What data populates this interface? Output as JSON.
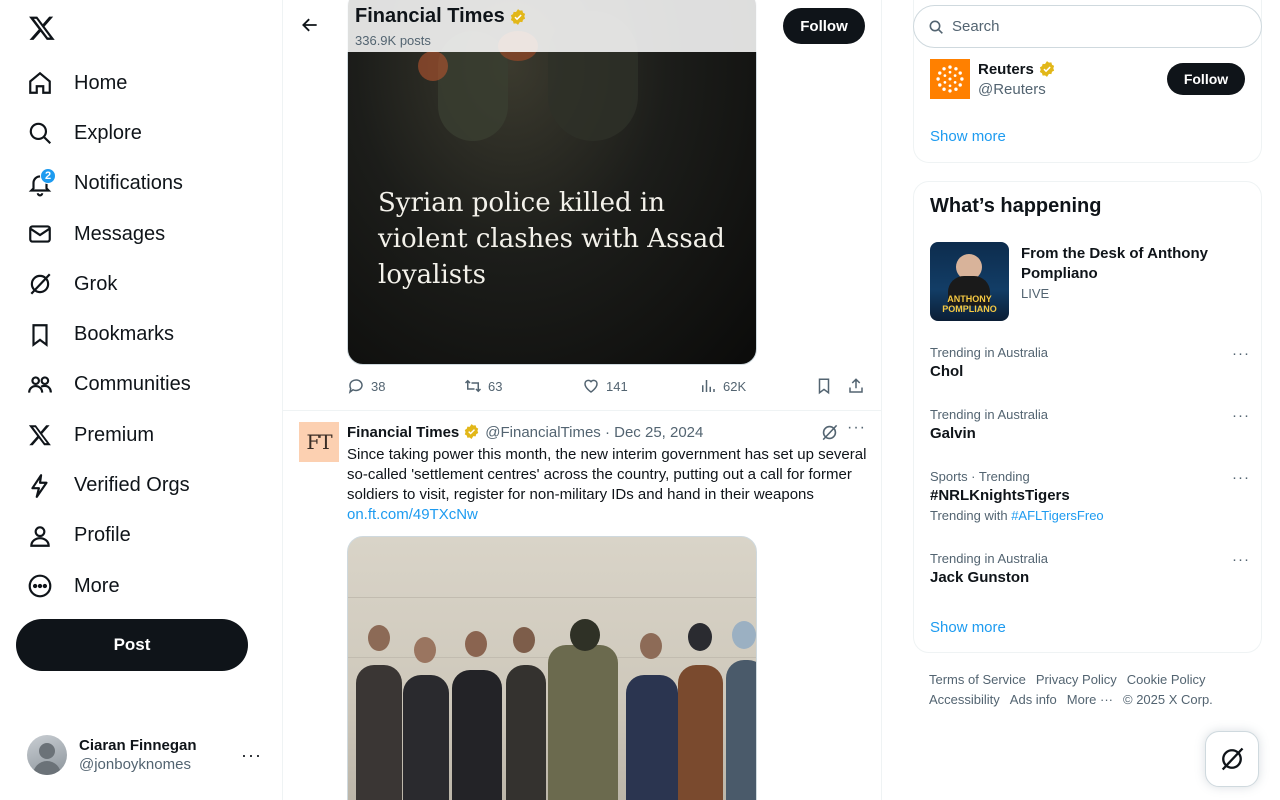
{
  "nav": {
    "items": [
      {
        "label": "Home",
        "icon": "home-icon"
      },
      {
        "label": "Explore",
        "icon": "search-icon"
      },
      {
        "label": "Notifications",
        "icon": "bell-icon",
        "badge": "2"
      },
      {
        "label": "Messages",
        "icon": "envelope-icon"
      },
      {
        "label": "Grok",
        "icon": "grok-icon"
      },
      {
        "label": "Bookmarks",
        "icon": "bookmark-icon"
      },
      {
        "label": "Communities",
        "icon": "people-icon"
      },
      {
        "label": "Premium",
        "icon": "x-logo-icon"
      },
      {
        "label": "Verified Orgs",
        "icon": "lightning-icon"
      },
      {
        "label": "Profile",
        "icon": "person-icon"
      },
      {
        "label": "More",
        "icon": "more-circle-icon"
      }
    ],
    "post_label": "Post",
    "account": {
      "name": "Ciaran Finnegan",
      "handle": "@jonboyknomes",
      "more": "···"
    }
  },
  "header": {
    "title": "Financial Times",
    "subtitle": "336.9K posts",
    "follow_label": "Follow"
  },
  "top_post": {
    "image_headline": "Syrian police killed in violent clashes with Assad loyalists",
    "actions": {
      "replies": "38",
      "reposts": "63",
      "likes": "141",
      "views": "62K"
    }
  },
  "tweet": {
    "avatar_text": "FT",
    "author": "Financial Times",
    "meta": "@FinancialTimes · Dec 25, 2024",
    "more": "···",
    "text": "Since taking power this month, the new interim government has set up several so-called 'settlement centres' across the country, putting out a call for former soldiers to visit, register for non-military IDs and hand in their weapons ",
    "link": "on.ft.com/49TXcNw"
  },
  "search": {
    "placeholder": "Search"
  },
  "who_to_follow": {
    "name": "Reuters",
    "handle": "@Reuters",
    "follow_label": "Follow",
    "show_more": "Show more"
  },
  "trends": {
    "title": "What’s happening",
    "live": {
      "title": "From the Desk of Anthony Pompliano",
      "tag": "LIVE",
      "thumb_caption": "ANTHONY POMPLIANO"
    },
    "items": [
      {
        "context": "Trending in Australia",
        "topic": "Chol"
      },
      {
        "context": "Trending in Australia",
        "topic": "Galvin"
      },
      {
        "context": "Sports · Trending",
        "topic": "#NRLKnightsTigers",
        "with_label": "Trending with",
        "with_tag": "#AFLTigersFreo"
      },
      {
        "context": "Trending in Australia",
        "topic": "Jack Gunston"
      }
    ],
    "dots": "···",
    "show_more": "Show more"
  },
  "footer": {
    "links": [
      "Terms of Service",
      "Privacy Policy",
      "Cookie Policy",
      "Accessibility",
      "Ads info",
      "More ···",
      "© 2025 X Corp."
    ]
  },
  "colors": {
    "accent": "#1d9bf0",
    "text": "#0f1419",
    "muted": "#536471",
    "verified_gold": "#e2b719",
    "ft_pink": "#fcd0b1",
    "reuters_orange": "#ff8000"
  }
}
